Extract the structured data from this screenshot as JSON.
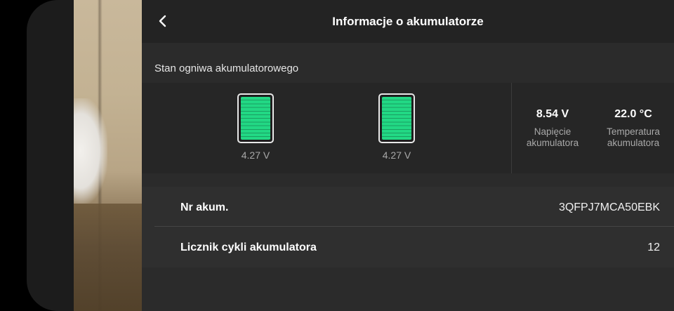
{
  "header": {
    "title": "Informacje o akumulatorze",
    "back_icon": "chevron-left-icon"
  },
  "cells_section": {
    "title": "Stan ogniwa akumulatorowego",
    "cells": [
      {
        "voltage": "4.27 V",
        "level": 1.0
      },
      {
        "voltage": "4.27 V",
        "level": 1.0
      }
    ],
    "cell_color": "#22d884"
  },
  "stats": {
    "voltage": {
      "value": "8.54 V",
      "label": "Napięcie akumulatora"
    },
    "temperature": {
      "value": "22.0 °C",
      "label": "Temperatura akumulatora"
    }
  },
  "info": {
    "serial": {
      "label": "Nr akum.",
      "value": "3QFPJ7MCA50EBK"
    },
    "cycles": {
      "label": "Licznik cykli akumulatora",
      "value": "12"
    }
  }
}
